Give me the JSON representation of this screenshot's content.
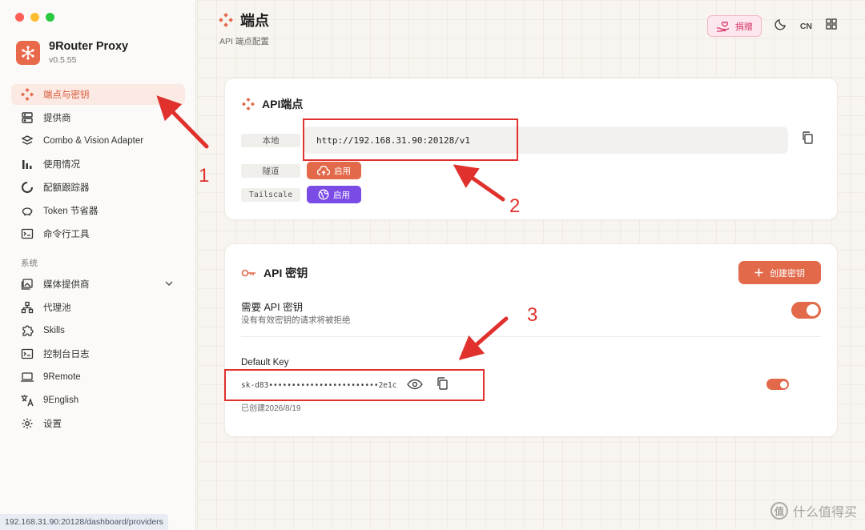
{
  "app": {
    "name": "9Router Proxy",
    "version": "v0.5.55"
  },
  "sidebar": {
    "items": [
      {
        "label": "端点与密钥",
        "icon": "endpoint-icon",
        "active": true
      },
      {
        "label": "提供商",
        "icon": "server-icon"
      },
      {
        "label": "Combo & Vision Adapter",
        "icon": "layers-icon"
      },
      {
        "label": "使用情况",
        "icon": "bar-chart-icon"
      },
      {
        "label": "配额跟踪器",
        "icon": "ring-icon"
      },
      {
        "label": "Token 节省器",
        "icon": "piggy-bank-icon"
      },
      {
        "label": "命令行工具",
        "icon": "terminal-icon"
      }
    ],
    "section_label": "系统",
    "system_items": [
      {
        "label": "媒体提供商",
        "icon": "media-icon"
      },
      {
        "label": "代理池",
        "icon": "network-icon"
      },
      {
        "label": "Skills",
        "icon": "puzzle-icon"
      },
      {
        "label": "控制台日志",
        "icon": "console-icon"
      },
      {
        "label": "9Remote",
        "icon": "laptop-icon"
      },
      {
        "label": "9English",
        "icon": "translate-icon"
      },
      {
        "label": "设置",
        "icon": "gear-icon"
      }
    ]
  },
  "status_url": "192.168.31.90:20128/dashboard/providers",
  "header": {
    "title": "端点",
    "subtitle": "API 端点配置",
    "donate_label": "捐赠",
    "lang_label": "CN"
  },
  "endpoint_card": {
    "title": "API端点",
    "local_label": "本地",
    "local_url": "http://192.168.31.90:20128/v1",
    "tunnel_label": "隧道",
    "tunnel_button": "启用",
    "tailscale_label": "Tailscale",
    "tailscale_button": "启用"
  },
  "keys_card": {
    "title": "API 密钥",
    "create_button": "创建密钥",
    "require_title": "需要 API 密钥",
    "require_desc": "没有有效密钥的请求将被拒绝",
    "require_enabled": true,
    "key_name": "Default Key",
    "key_value": "sk-d83••••••••••••••••••••••••2e1c",
    "key_created": "已创建2026/8/19",
    "key_enabled": true
  },
  "annotations": {
    "n1": "1",
    "n2": "2",
    "n3": "3"
  },
  "watermark": {
    "badge": "值",
    "text": "什么值得买"
  },
  "colors": {
    "accent": "#e2694a",
    "purple": "#7b4be6",
    "annotation_red": "#e0312d",
    "active_bg": "#fbe9e3"
  }
}
